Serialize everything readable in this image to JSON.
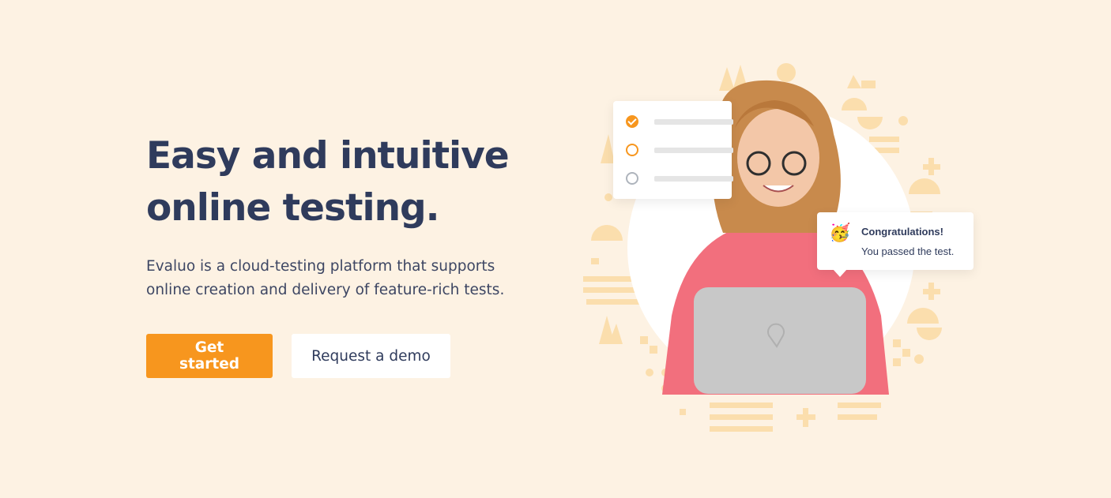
{
  "hero": {
    "headline_line1": "Easy and intuitive",
    "headline_line2": "online testing.",
    "subtitle_line1": "Evaluo is a cloud-testing platform that supports",
    "subtitle_line2": "online creation and delivery of feature-rich tests.",
    "primary_button": "Get started",
    "secondary_button": "Request a demo"
  },
  "illustration": {
    "checklist": [
      {
        "state": "checked",
        "icon": "checkmark-circle-icon"
      },
      {
        "state": "in-progress",
        "icon": "empty-circle-icon"
      },
      {
        "state": "unchecked",
        "icon": "empty-circle-icon"
      }
    ],
    "toast": {
      "icon": "party-face-icon",
      "emoji": "🥳",
      "title": "Congratulations!",
      "message": "You passed the test."
    }
  },
  "colors": {
    "background": "#fdf2e3",
    "accent": "#f7961e",
    "text": "#2f3b5c",
    "decoration": "#fbdca8"
  }
}
